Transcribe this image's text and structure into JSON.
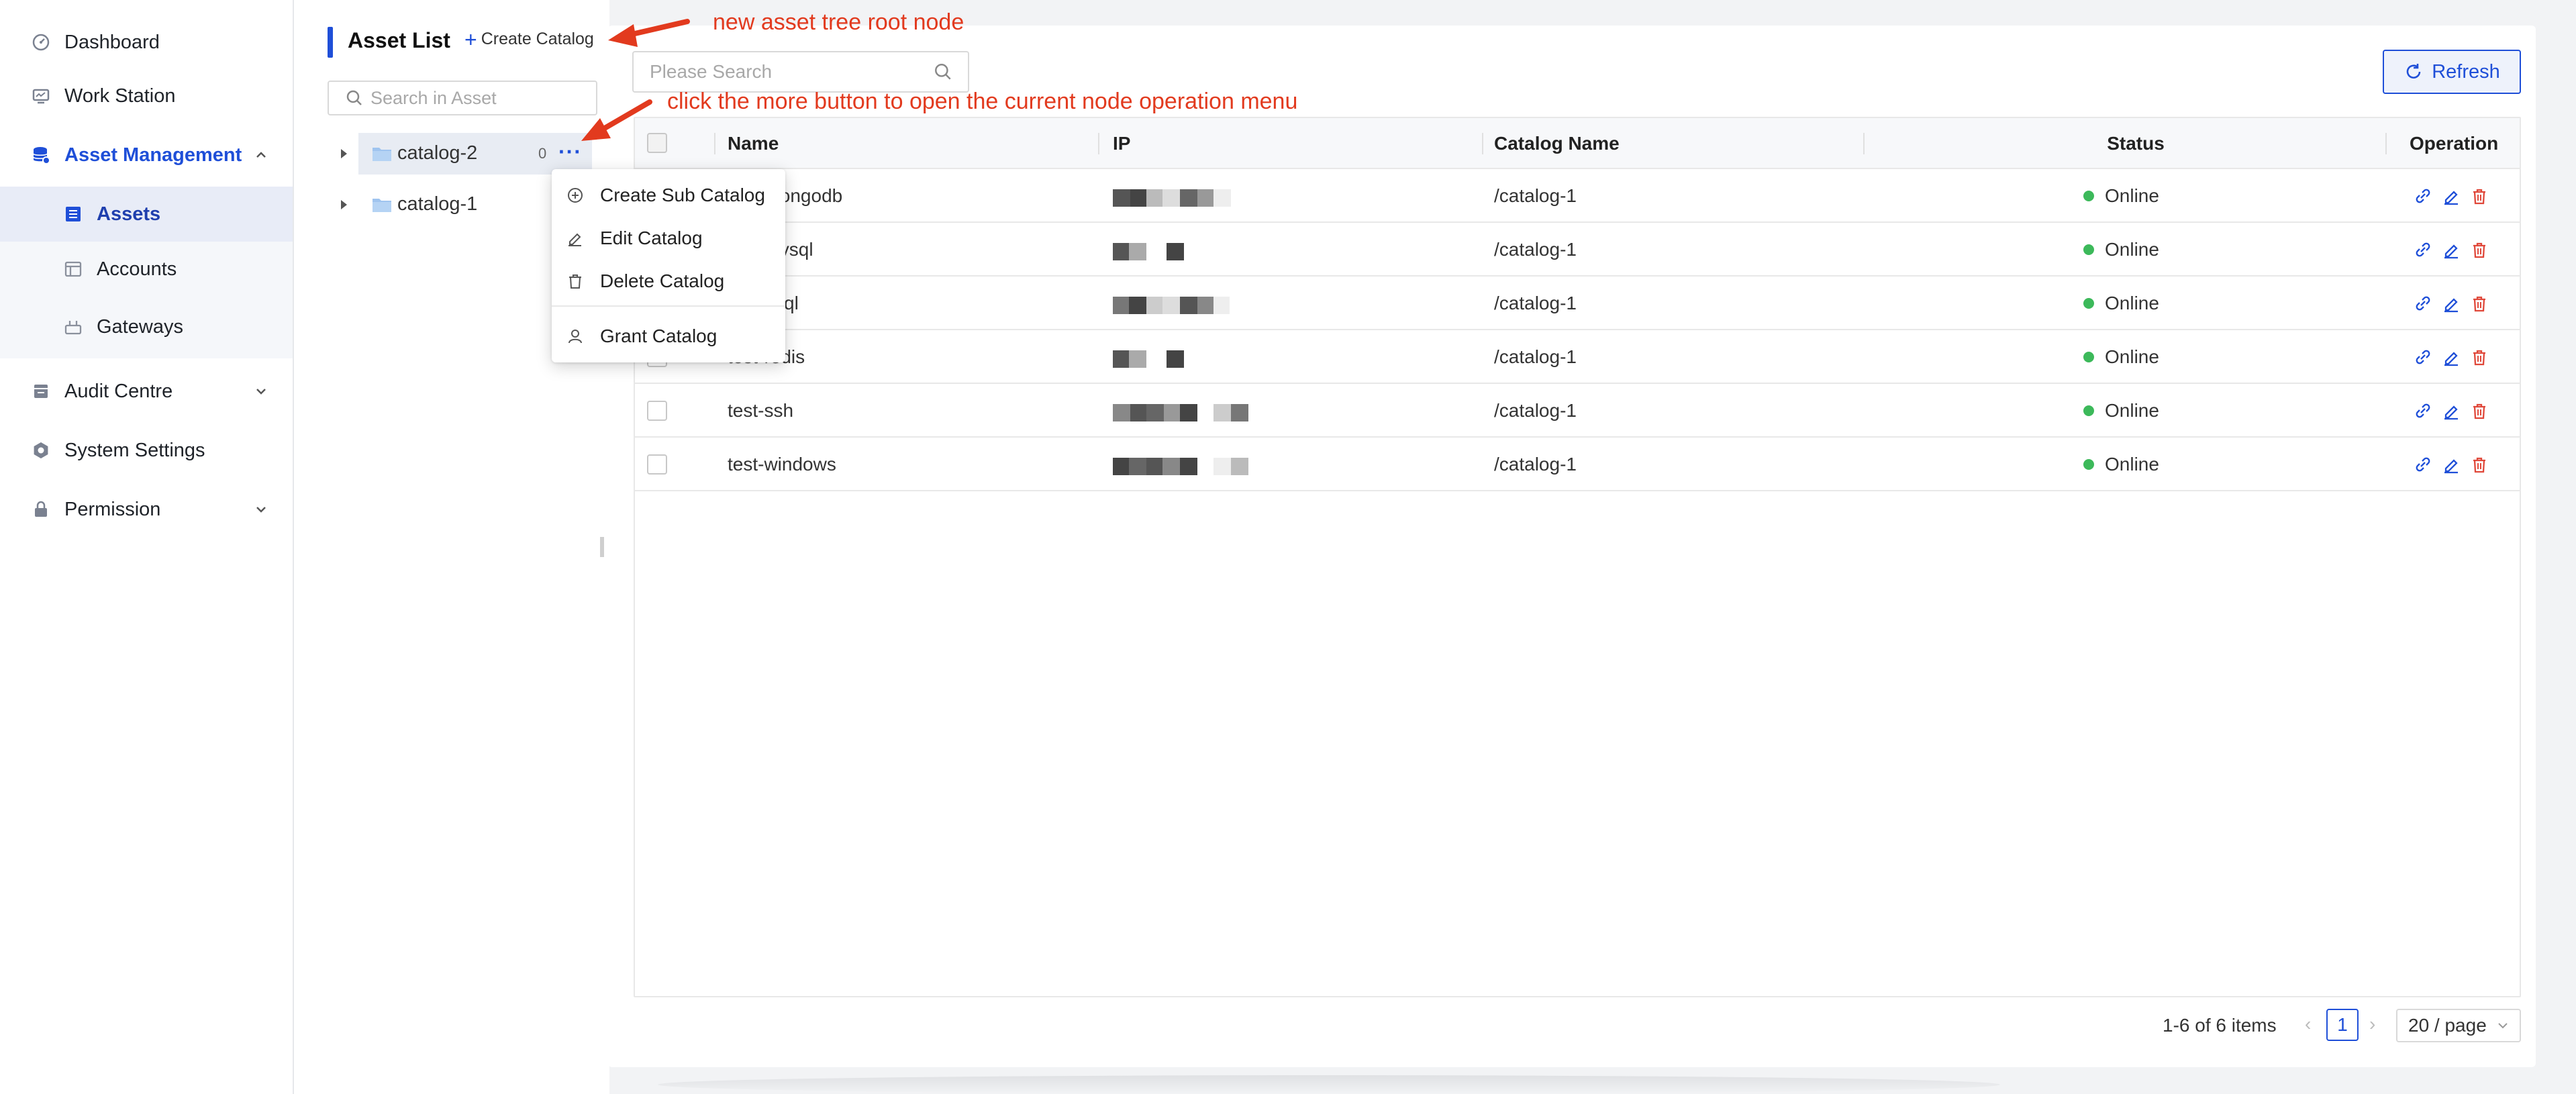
{
  "sidebar": {
    "items": [
      {
        "label": "Dashboard",
        "icon": "dashboard-icon"
      },
      {
        "label": "Work Station",
        "icon": "workstation-icon"
      },
      {
        "label": "Asset Management",
        "icon": "database-icon"
      },
      {
        "label": "Assets",
        "icon": "assets-icon"
      },
      {
        "label": "Accounts",
        "icon": "accounts-icon"
      },
      {
        "label": "Gateways",
        "icon": "gateway-icon"
      },
      {
        "label": "Audit Centre",
        "icon": "audit-icon"
      },
      {
        "label": "System Settings",
        "icon": "gear-icon"
      },
      {
        "label": "Permission",
        "icon": "lock-icon"
      }
    ]
  },
  "tree": {
    "title": "Asset List",
    "create_label": "Create Catalog",
    "search_placeholder": "Search in Asset",
    "nodes": [
      {
        "label": "catalog-2",
        "count": "0"
      },
      {
        "label": "catalog-1"
      }
    ],
    "menu": {
      "items": [
        {
          "label": "Create Sub Catalog",
          "icon": "plus-circle-icon"
        },
        {
          "label": "Edit Catalog",
          "icon": "edit-icon"
        },
        {
          "label": "Delete Catalog",
          "icon": "trash-icon"
        },
        {
          "label": "Grant Catalog",
          "icon": "user-icon"
        }
      ]
    }
  },
  "main": {
    "search_placeholder": "Please Search",
    "refresh_label": "Refresh",
    "table": {
      "columns": [
        "Name",
        "IP",
        "Catalog Name",
        "Status",
        "Operation"
      ],
      "rows": [
        {
          "name": "test-mongodb",
          "catalog": "/catalog-1",
          "status": "Online"
        },
        {
          "name": "test-mysql",
          "catalog": "/catalog-1",
          "status": "Online"
        },
        {
          "name": "test-psql",
          "catalog": "/catalog-1",
          "status": "Online"
        },
        {
          "name": "test-redis",
          "catalog": "/catalog-1",
          "status": "Online"
        },
        {
          "name": "test-ssh",
          "catalog": "/catalog-1",
          "status": "Online"
        },
        {
          "name": "test-windows",
          "catalog": "/catalog-1",
          "status": "Online"
        }
      ]
    },
    "pagination": {
      "info": "1-6 of 6 items",
      "current": "1",
      "page_size": "20 / page"
    }
  },
  "annotations": {
    "create": "new asset tree root node",
    "more": "click the more button to open the current node operation menu"
  },
  "colors": {
    "accent": "#1f4fd8",
    "online": "#3cb95a",
    "danger": "#e0483a",
    "annotation": "#e23a1e"
  }
}
